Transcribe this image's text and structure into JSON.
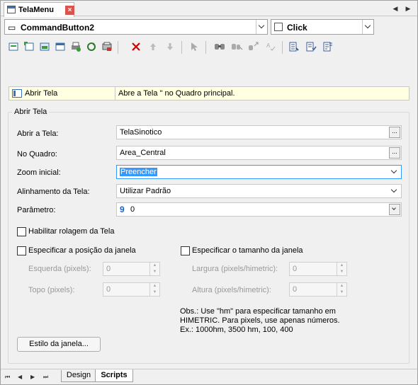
{
  "window": {
    "tab_title": "TelaMenu",
    "close_glyph": "×",
    "nav_prev": "◀",
    "nav_next": "▶"
  },
  "object_selector": {
    "value": "CommandButton2",
    "prefix": "▭"
  },
  "event_selector": {
    "value": "Click"
  },
  "toolbar": {
    "icons": [
      "new-pick-icon",
      "add-pick-icon",
      "open-screen-icon",
      "close-screen-icon",
      "print-icon",
      "refresh-icon",
      "script-icon",
      "delete-icon",
      "move-up-icon",
      "move-down-icon",
      "ai-cursor-icon",
      "find-icon",
      "find-next-icon",
      "replace-icon",
      "spell-check-icon",
      "list-icon",
      "list-check-icon",
      "list-edit-icon"
    ]
  },
  "command": {
    "name": "Abrir Tela",
    "description": "Abre a Tela \" no Quadro principal."
  },
  "group": {
    "title": "Abrir Tela",
    "abrir_tela": {
      "label": "Abrir a Tela:",
      "value": "TelaSinotico",
      "button": "..."
    },
    "no_quadro": {
      "label": "No Quadro:",
      "value": "Area_Central",
      "button": "..."
    },
    "zoom": {
      "label": "Zoom inicial:",
      "value": "Preencher"
    },
    "alinhamento": {
      "label": "Alinhamento da Tela:",
      "value": "Utilizar Padrão"
    },
    "parametro": {
      "label": "Parâmetro:",
      "value": "0",
      "type_glyph": "9"
    },
    "rolagem": {
      "label": "Habilitar rolagem da Tela",
      "checked": false
    },
    "posicao": {
      "label": "Especificar a posição da janela",
      "checked": false,
      "esquerda": {
        "label": "Esquerda (pixels):",
        "value": "0"
      },
      "topo": {
        "label": "Topo (pixels):",
        "value": "0"
      }
    },
    "tamanho": {
      "label": "Especificar o tamanho da janela",
      "checked": false,
      "largura": {
        "label": "Largura (pixels/himetric):",
        "value": "0"
      },
      "altura": {
        "label": "Altura (pixels/himetric):",
        "value": "0"
      }
    },
    "obs": [
      "Obs.: Use \"hm\" para especificar tamanho em",
      "HIMETRIC. Para pixels, use apenas números.",
      "Ex.: 1000hm, 3500 hm, 100, 400"
    ],
    "estilo_button": "Estilo da janela..."
  },
  "bottom_tabs": {
    "nav": [
      "⏮",
      "◀",
      "▶",
      "⏭"
    ],
    "design": "Design",
    "scripts": "Scripts"
  },
  "colors": {
    "accent": "#3399ff",
    "row_bg": "#ffffe1",
    "delete": "#cc0000"
  }
}
